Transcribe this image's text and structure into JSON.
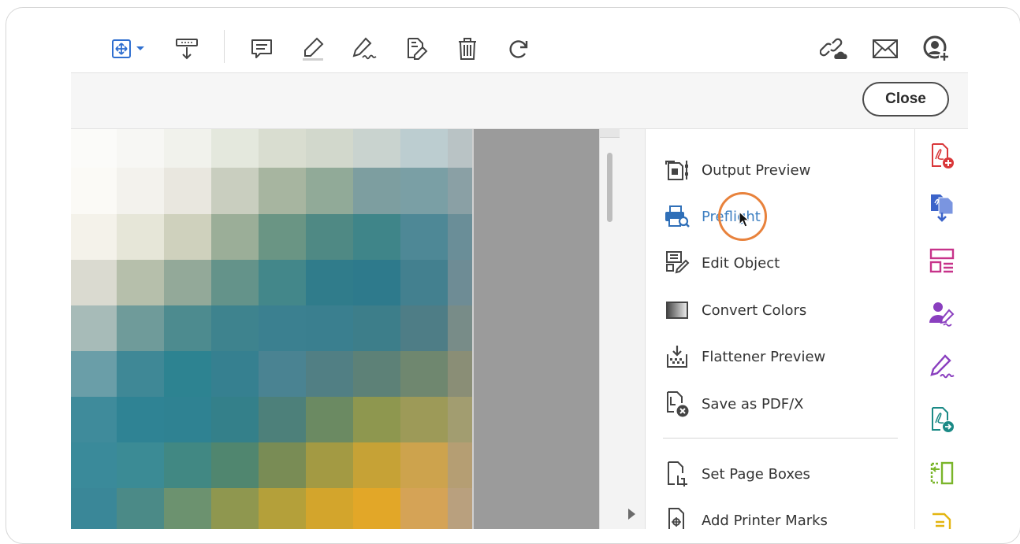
{
  "toolbar": {
    "icons": [
      "move-tool-icon",
      "chevron-down-icon",
      "download-tray-icon",
      "comment-icon",
      "highlighter-icon",
      "sign-pen-icon",
      "edit-document-icon",
      "trash-icon",
      "redo-icon",
      "link-cloud-icon",
      "mail-icon",
      "add-user-icon"
    ]
  },
  "subbar": {
    "close_label": "Close"
  },
  "tools_panel": {
    "items": [
      {
        "label": "Output Preview",
        "icon": "output-preview-icon"
      },
      {
        "label": "Preflight",
        "icon": "preflight-icon",
        "active": true
      },
      {
        "label": "Edit Object",
        "icon": "edit-object-icon"
      },
      {
        "label": "Convert Colors",
        "icon": "convert-colors-icon"
      },
      {
        "label": "Flattener Preview",
        "icon": "flattener-preview-icon"
      },
      {
        "label": "Save as PDF/X",
        "icon": "save-pdfx-icon"
      },
      {
        "label": "Set Page Boxes",
        "icon": "set-page-boxes-icon"
      },
      {
        "label": "Add Printer Marks",
        "icon": "add-printer-marks-icon"
      }
    ]
  },
  "right_rail": {
    "icons": [
      "create-pdf-icon",
      "export-pdf-icon",
      "organize-pages-icon",
      "request-signature-icon",
      "fill-sign-icon",
      "share-pdf-icon",
      "compare-icon",
      "notes-icon"
    ]
  },
  "colors": {
    "accent": "#3d7fc1",
    "cursor_ring": "#e8823c",
    "rail_red": "#d9383a",
    "rail_blue": "#3b63c9",
    "rail_magenta": "#c7338a",
    "rail_purple": "#8a3fbf",
    "rail_teal": "#1b8a86",
    "rail_green": "#7ab52a",
    "rail_yellow": "#e3b511"
  },
  "document": {
    "pixel_colors": [
      [
        "#fbfbf9",
        "#f7f7f4",
        "#f1f2ec",
        "#e4e8dd",
        "#d9ddd0",
        "#d2d8cc",
        "#c9d3cf",
        "#bccdd0",
        "#b9c3c5"
      ],
      [
        "#fbfaf6",
        "#f3f2ed",
        "#e9e7df",
        "#c9cebf",
        "#a7b5a0",
        "#91aa98",
        "#7d9ea0",
        "#7a9fa5",
        "#8aa0a5"
      ],
      [
        "#f4f2ea",
        "#e6e6d8",
        "#cfd1bd",
        "#9bae98",
        "#6a9584",
        "#4f8984",
        "#3f8589",
        "#4e8896",
        "#6a8e98"
      ],
      [
        "#dadad0",
        "#b6bfab",
        "#93a999",
        "#64938a",
        "#43878a",
        "#307c8b",
        "#2e7a8c",
        "#43808f",
        "#6e8c95"
      ],
      [
        "#a7bbb8",
        "#6f9b9a",
        "#4d8b8f",
        "#3e838e",
        "#3b8090",
        "#3a7f8f",
        "#3d7e8a",
        "#4e7d86",
        "#788c88"
      ],
      [
        "#6a9ea8",
        "#3f8896",
        "#2d8391",
        "#368090",
        "#4a8392",
        "#517f84",
        "#5d8177",
        "#6f876f",
        "#8a8e76"
      ],
      [
        "#3f8b9b",
        "#2f8394",
        "#2f8292",
        "#34808a",
        "#4d807a",
        "#6b8a62",
        "#8e974f",
        "#9d9a58",
        "#a29d70"
      ],
      [
        "#3a8a9a",
        "#3b8b95",
        "#418883",
        "#50866f",
        "#798c55",
        "#a39a43",
        "#c6a236",
        "#cda34d",
        "#b59e73"
      ],
      [
        "#3a8798",
        "#4b8a87",
        "#6c926f",
        "#8f974f",
        "#b4a03a",
        "#d3a52c",
        "#e2a728",
        "#d5a356",
        "#b9a07e"
      ]
    ]
  }
}
